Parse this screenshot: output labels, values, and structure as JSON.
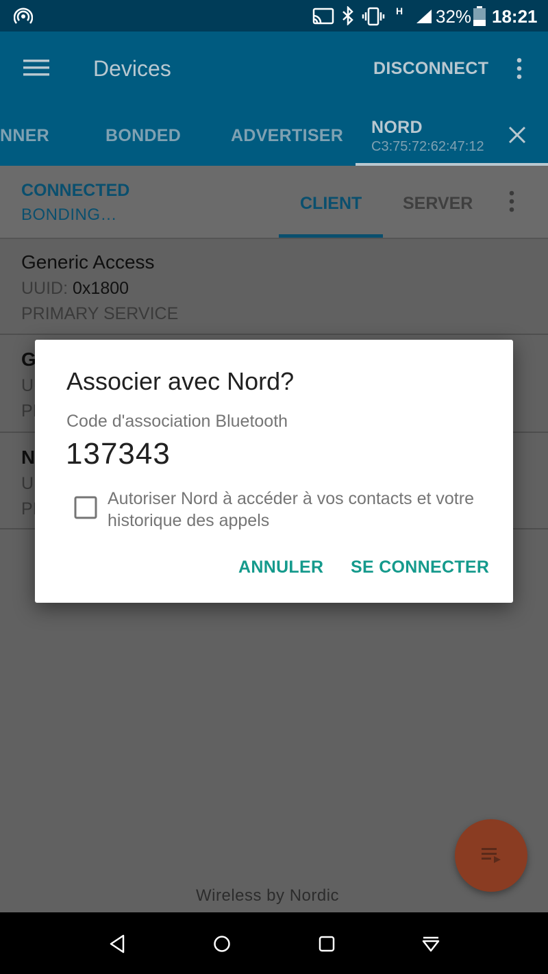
{
  "status_bar": {
    "battery": "32%",
    "time": "18:21"
  },
  "app_bar": {
    "title": "Devices",
    "action": "DISCONNECT",
    "tabs": [
      {
        "label": "NNER"
      },
      {
        "label": "BONDED"
      },
      {
        "label": "ADVERTISER"
      },
      {
        "label": "NORD",
        "sublabel": "C3:75:72:62:47:12"
      }
    ]
  },
  "connection": {
    "status": "CONNECTED",
    "bond_status": "BONDING…",
    "tabs": [
      {
        "label": "CLIENT"
      },
      {
        "label": "SERVER"
      }
    ]
  },
  "services": [
    {
      "name": "Generic Access",
      "uuid_label": "UUID:",
      "uuid": "0x1800",
      "type": "PRIMARY SERVICE"
    },
    {
      "name": "G",
      "uuid_label": "UU",
      "type": "PI"
    },
    {
      "name": "N",
      "uuid_label": "UI",
      "type": "PI"
    }
  ],
  "dialog": {
    "title": "Associer avec Nord?",
    "label": "Code d'association Bluetooth",
    "code": "137343",
    "checkbox_line1": "Autoriser Nord à accéder à vos contacts et votre",
    "checkbox_line2": "historique des appels",
    "cancel": "ANNULER",
    "confirm": "SE CONNECTER"
  },
  "footer": "Wireless by Nordic",
  "colors": {
    "status_bar": "#003c58",
    "app_bar": "#005b80",
    "accent": "#159a8c",
    "fab": "#8a3c22"
  },
  "icons": [
    "hotspot-icon",
    "cast-icon",
    "bluetooth-icon",
    "vibrate-icon",
    "signal-icon",
    "battery-icon",
    "menu-icon",
    "overflow-icon",
    "close-icon",
    "checkbox-icon",
    "log-icon",
    "back-icon",
    "home-icon",
    "recents-icon",
    "notifications-icon"
  ]
}
